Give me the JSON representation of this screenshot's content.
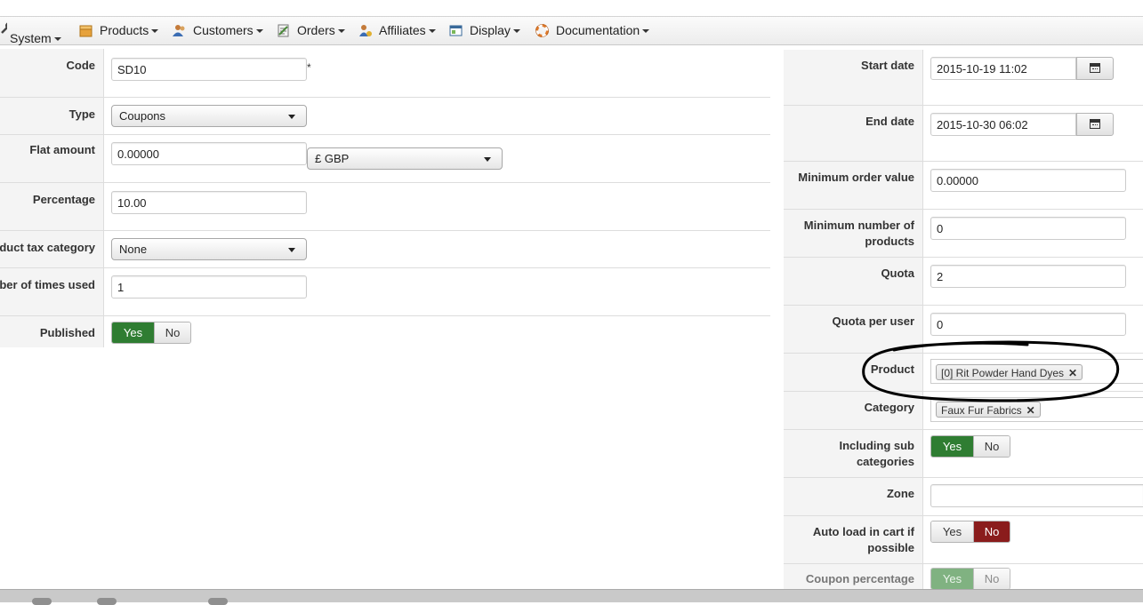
{
  "menu": [
    {
      "label": "System",
      "icon": "wrench-icon"
    },
    {
      "label": "Products",
      "icon": "box-icon"
    },
    {
      "label": "Customers",
      "icon": "users-icon"
    },
    {
      "label": "Orders",
      "icon": "orders-icon"
    },
    {
      "label": "Affiliates",
      "icon": "affiliates-icon"
    },
    {
      "label": "Display",
      "icon": "display-icon"
    },
    {
      "label": "Documentation",
      "icon": "lifebuoy-icon"
    }
  ],
  "left": {
    "code": {
      "label": "Code",
      "value": "SD10",
      "required": "*"
    },
    "type": {
      "label": "Type",
      "value": "Coupons"
    },
    "flat_amount": {
      "label": "Flat amount",
      "value": "0.00000",
      "currency": "£ GBP"
    },
    "percentage": {
      "label": "Percentage",
      "value": "10.00"
    },
    "tax": {
      "label": "duct tax category",
      "value": "None"
    },
    "times_used": {
      "label": "ber of times used",
      "value": "1"
    },
    "published": {
      "label": "Published",
      "yes": "Yes",
      "no": "No",
      "selected": "Yes"
    }
  },
  "right": {
    "start_date": {
      "label": "Start date",
      "value": "2015-10-19 11:02"
    },
    "end_date": {
      "label": "End date",
      "value": "2015-10-30 06:02"
    },
    "min_order": {
      "label": "Minimum order value",
      "value": "0.00000"
    },
    "min_products": {
      "label1": "Minimum number of",
      "label2": "products",
      "value": "0"
    },
    "quota": {
      "label": "Quota",
      "value": "2"
    },
    "quota_user": {
      "label": "Quota per user",
      "value": "0"
    },
    "product": {
      "label": "Product",
      "tag": "[0] Rit Powder Hand Dyes"
    },
    "category": {
      "label": "Category",
      "tag": "Faux Fur Fabrics"
    },
    "sub_categories": {
      "label1": "Including sub",
      "label2": "categories",
      "yes": "Yes",
      "no": "No",
      "selected": "Yes"
    },
    "zone": {
      "label": "Zone",
      "value": ""
    },
    "auto_load": {
      "label1": "Auto load in cart if",
      "label2": "possible",
      "yes": "Yes",
      "no": "No",
      "selected": "No"
    },
    "coupon_pct": {
      "label": "Coupon percentage",
      "yes": "Yes",
      "no": "No",
      "selected": "Yes"
    }
  },
  "colors": {
    "yes_active": "#2f7d32",
    "no_active": "#8a1c1c",
    "annotation": "#000000"
  }
}
